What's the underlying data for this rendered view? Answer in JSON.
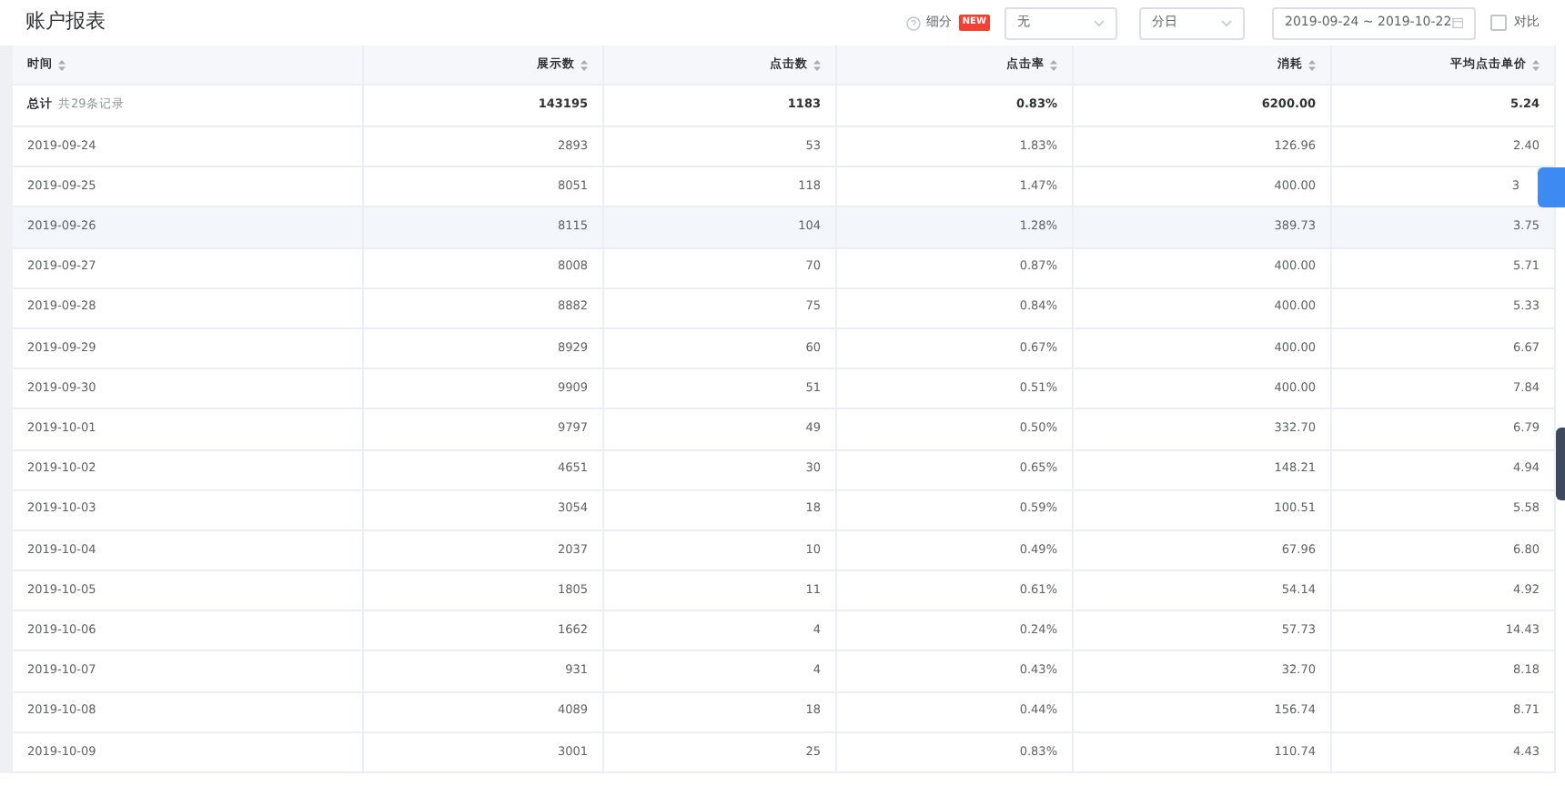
{
  "title": "账户报表",
  "toolbar": {
    "breakdown_label": "细分",
    "badge": "NEW",
    "breakdown_select": "无",
    "granularity_select": "分日",
    "date_range": "2019-09-24 ~ 2019-10-22",
    "compare": {
      "label": "对比",
      "checked": false
    }
  },
  "table": {
    "columns": [
      "时间",
      "展示数",
      "点击数",
      "点击率",
      "消耗",
      "平均点击单价"
    ],
    "total": {
      "label": "总计",
      "note": "共29条记录",
      "cells": [
        "143195",
        "1183",
        "0.83%",
        "6200.00",
        "5.24"
      ]
    },
    "rows": [
      {
        "cells": [
          "2019-09-24",
          "2893",
          "53",
          "1.83%",
          "126.96",
          "2.40"
        ],
        "highlighted": false
      },
      {
        "cells": [
          "2019-09-25",
          "8051",
          "118",
          "1.47%",
          "400.00",
          "3"
        ],
        "highlighted": false
      },
      {
        "cells": [
          "2019-09-26",
          "8115",
          "104",
          "1.28%",
          "389.73",
          "3.75"
        ],
        "highlighted": true
      },
      {
        "cells": [
          "2019-09-27",
          "8008",
          "70",
          "0.87%",
          "400.00",
          "5.71"
        ],
        "highlighted": false
      },
      {
        "cells": [
          "2019-09-28",
          "8882",
          "75",
          "0.84%",
          "400.00",
          "5.33"
        ],
        "highlighted": false
      },
      {
        "cells": [
          "2019-09-29",
          "8929",
          "60",
          "0.67%",
          "400.00",
          "6.67"
        ],
        "highlighted": false
      },
      {
        "cells": [
          "2019-09-30",
          "9909",
          "51",
          "0.51%",
          "400.00",
          "7.84"
        ],
        "highlighted": false
      },
      {
        "cells": [
          "2019-10-01",
          "9797",
          "49",
          "0.50%",
          "332.70",
          "6.79"
        ],
        "highlighted": false
      },
      {
        "cells": [
          "2019-10-02",
          "4651",
          "30",
          "0.65%",
          "148.21",
          "4.94"
        ],
        "highlighted": false
      },
      {
        "cells": [
          "2019-10-03",
          "3054",
          "18",
          "0.59%",
          "100.51",
          "5.58"
        ],
        "highlighted": false
      },
      {
        "cells": [
          "2019-10-04",
          "2037",
          "10",
          "0.49%",
          "67.96",
          "6.80"
        ],
        "highlighted": false
      },
      {
        "cells": [
          "2019-10-05",
          "1805",
          "11",
          "0.61%",
          "54.14",
          "4.92"
        ],
        "highlighted": false
      },
      {
        "cells": [
          "2019-10-06",
          "1662",
          "4",
          "0.24%",
          "57.73",
          "14.43"
        ],
        "highlighted": false
      },
      {
        "cells": [
          "2019-10-07",
          "931",
          "4",
          "0.43%",
          "32.70",
          "8.18"
        ],
        "highlighted": false
      },
      {
        "cells": [
          "2019-10-08",
          "4089",
          "18",
          "0.44%",
          "156.74",
          "8.71"
        ],
        "highlighted": false
      },
      {
        "cells": [
          "2019-10-09",
          "3001",
          "25",
          "0.83%",
          "110.74",
          "4.43"
        ],
        "highlighted": false
      }
    ]
  }
}
